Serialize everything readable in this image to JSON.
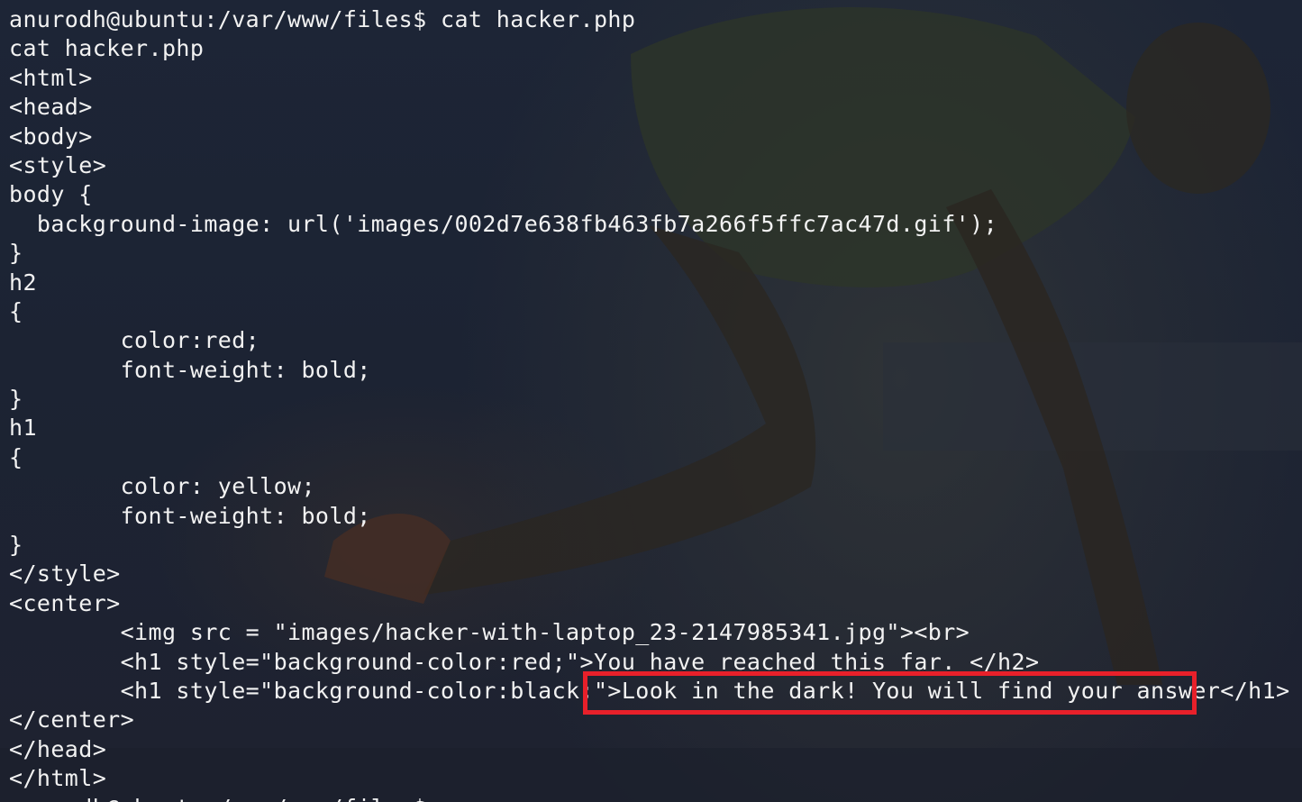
{
  "terminal": {
    "lines": [
      "anurodh@ubuntu:/var/www/files$ cat hacker.php",
      "cat hacker.php",
      "<html>",
      "<head>",
      "<body>",
      "<style>",
      "body {",
      "  background-image: url('images/002d7e638fb463fb7a266f5ffc7ac47d.gif');",
      "}",
      "h2",
      "{",
      "        color:red;",
      "        font-weight: bold;",
      "}",
      "h1",
      "{",
      "        color: yellow;",
      "        font-weight: bold;",
      "}",
      "</style>",
      "<center>",
      "        <img src = \"images/hacker-with-laptop_23-2147985341.jpg\"><br>",
      "        <h1 style=\"background-color:red;\">You have reached this far. </h2>",
      "        <h1 style=\"background-color:black;\">Look in the dark! You will find your answer</h1>",
      "</center>",
      "</head>",
      "</html>",
      "anurodh@ubuntu:/var/www/files$"
    ],
    "highlight_color": "#e8202a",
    "text_color": "#f2f2f2",
    "background_color": "#1b2333"
  }
}
